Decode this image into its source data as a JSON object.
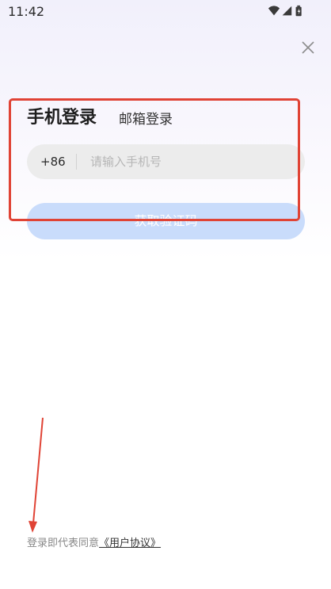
{
  "status_bar": {
    "time": "11:42",
    "icons": [
      "wifi-icon",
      "signal-icon",
      "battery-icon"
    ]
  },
  "login": {
    "close_icon": "close-icon",
    "tabs": [
      {
        "label": "手机登录",
        "active": true
      },
      {
        "label": "邮箱登录",
        "active": false
      }
    ],
    "country_code": "+86",
    "phone_placeholder": "请输入手机号",
    "phone_value": "",
    "get_code_label": "获取验证码"
  },
  "agreement": {
    "prefix": "登录即代表同意",
    "link_text": "《用户协议》"
  },
  "colors": {
    "accent_button": "#c9dcfb",
    "annotation_red": "#e04335",
    "input_bg": "#ececec"
  }
}
